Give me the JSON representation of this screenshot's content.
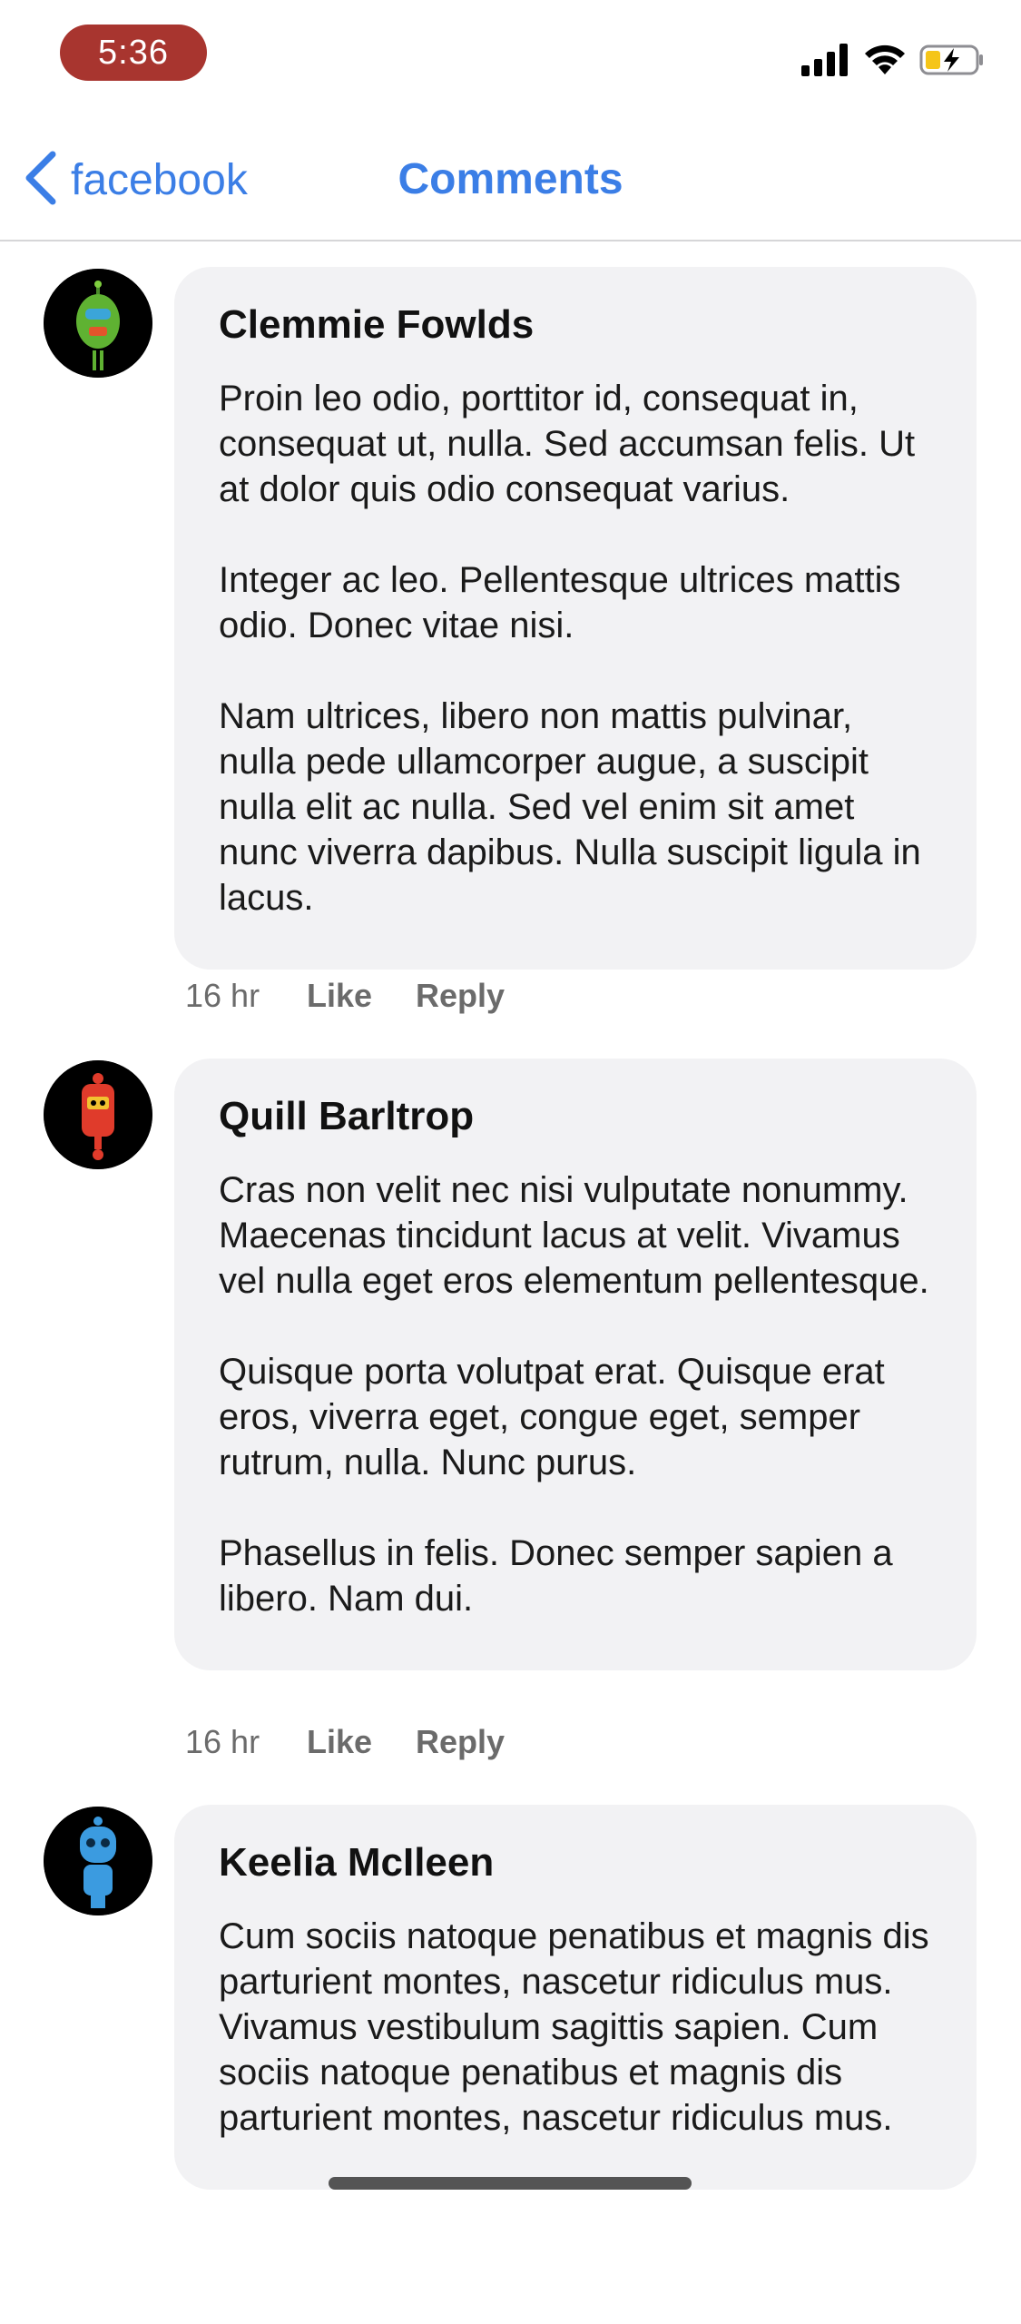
{
  "status_bar": {
    "time": "5:36",
    "icons": [
      "signal-icon",
      "wifi-icon",
      "battery-charging-icon"
    ]
  },
  "nav": {
    "back_label": "facebook",
    "title": "Comments"
  },
  "colors": {
    "accent": "#3b7ee6",
    "time_pill": "#a8352f",
    "bubble": "#f2f2f4",
    "meta_text": "#6b6b6b"
  },
  "comments": [
    {
      "author": "Clemmie Fowlds",
      "avatar": "green-robot-avatar",
      "paragraphs": [
        "Proin leo odio, porttitor id, consequat in, consequat ut, nulla. Sed accumsan felis. Ut at dolor quis odio consequat varius.",
        "Integer ac leo. Pellentesque ultrices mattis odio. Donec vitae nisi.",
        "Nam ultrices, libero non mattis pulvinar, nulla pede ullamcorper augue, a suscipit nulla elit ac nulla. Sed vel enim sit amet nunc viverra dapibus. Nulla suscipit ligula in lacus."
      ],
      "time": "16 hr",
      "like_label": "Like",
      "reply_label": "Reply"
    },
    {
      "author": "Quill Barltrop",
      "avatar": "red-robot-avatar",
      "paragraphs": [
        "Cras non velit nec nisi vulputate nonummy. Maecenas tincidunt lacus at velit. Vivamus vel nulla eget eros elementum pellentesque.",
        "Quisque porta volutpat erat. Quisque erat eros, viverra eget, congue eget, semper rutrum, nulla. Nunc purus.",
        "Phasellus in felis. Donec semper sapien a libero. Nam dui."
      ],
      "time": "16 hr",
      "like_label": "Like",
      "reply_label": "Reply"
    },
    {
      "author": "Keelia McIleen",
      "avatar": "blue-robot-avatar",
      "paragraphs": [
        "Cum sociis natoque penatibus et magnis dis parturient montes, nascetur ridiculus mus. Vivamus vestibulum sagittis sapien. Cum sociis natoque penatibus et magnis dis parturient montes, nascetur ridiculus mus."
      ]
    }
  ]
}
